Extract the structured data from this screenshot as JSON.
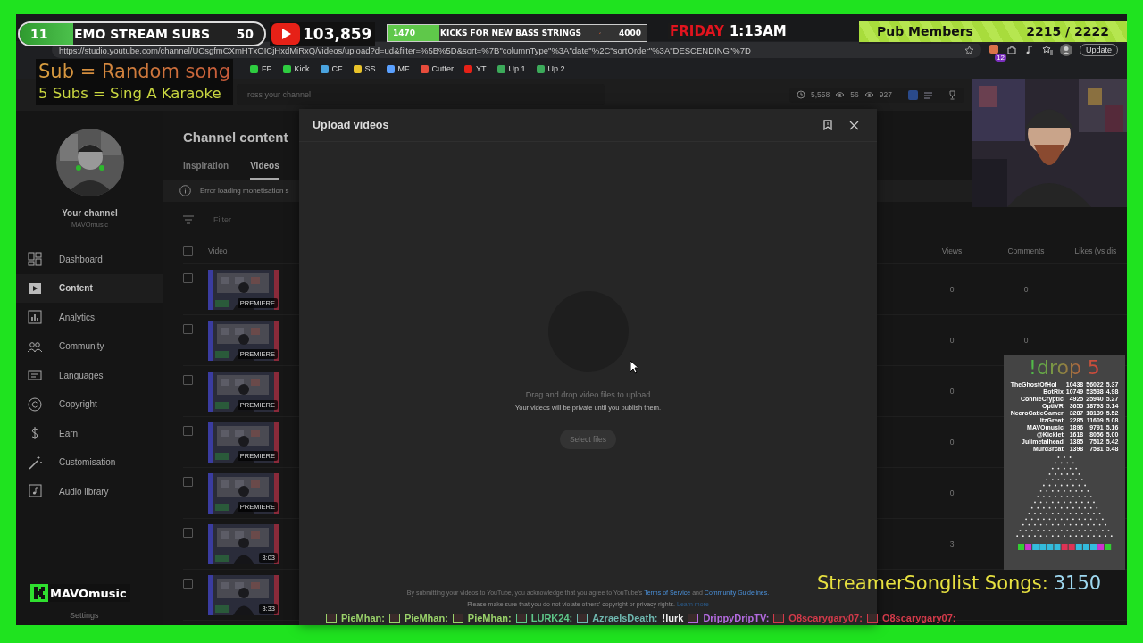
{
  "hud": {
    "subs": {
      "count": "11",
      "label": "EMO STREAM SUBS",
      "goal": "50",
      "level": 0.22
    },
    "youtube_subs": "103,859",
    "kicks": {
      "count": "1470",
      "label": "KICKS FOR NEW BASS STRINGS",
      "goal": "4000",
      "level": 0.2
    },
    "day": "FRIDAY",
    "time": "1:13AM",
    "members": {
      "label": "Pub Members",
      "count": "2215 / 2222"
    },
    "rules": [
      "Sub = Random song",
      "5 Subs = Sing A Karaoke"
    ],
    "drop": {
      "title": "!drop 5",
      "rows": [
        {
          "name": "TheGhostOfHol",
          "points": "10438",
          "total": "56022",
          "avg": "5.37"
        },
        {
          "name": "BotRix",
          "points": "10749",
          "total": "53538",
          "avg": "4.98"
        },
        {
          "name": "ConnieCryptic",
          "points": "4925",
          "total": "25940",
          "avg": "5.27"
        },
        {
          "name": "OptiVR",
          "points": "3655",
          "total": "18793",
          "avg": "5.14"
        },
        {
          "name": "NecroCatieGamer",
          "points": "3287",
          "total": "18139",
          "avg": "5.52"
        },
        {
          "name": "ItzGreat",
          "points": "2285",
          "total": "11609",
          "avg": "5.08"
        },
        {
          "name": "MAVOmusic",
          "points": "1896",
          "total": "9791",
          "avg": "5.16"
        },
        {
          "name": "@Kicklet",
          "points": "1618",
          "total": "8056",
          "avg": "5.00"
        },
        {
          "name": "Julimetalhead",
          "points": "1385",
          "total": "7512",
          "avg": "5.42"
        },
        {
          "name": "Murd3rcat",
          "points": "1398",
          "total": "7581",
          "avg": "5.48"
        }
      ]
    },
    "songlist": {
      "label": "StreamerSonglist Songs:",
      "count": "3150"
    },
    "kick_user": "MAVOmusic",
    "chat": [
      {
        "user": "PieMhan:",
        "color": "#9ad26a"
      },
      {
        "user": "PieMhan:",
        "color": "#9ad26a"
      },
      {
        "user": "PieMhan:",
        "color": "#9ad26a"
      },
      {
        "user": "LURK24:",
        "color": "#5fc98a"
      },
      {
        "user": "AzraelsDeath:",
        "color": "#6fb8b0",
        "message": "!lurk"
      },
      {
        "user": "DrippyDripTV:",
        "color": "#b46be0"
      },
      {
        "user": "O8scarygary07:",
        "color": "#d23a4a"
      },
      {
        "user": "O8scarygary07:",
        "color": "#d23a4a"
      }
    ]
  },
  "browser": {
    "url": "https://studio.youtube.com/channel/UCsgfmCXmHTxOICjHxdMiRxQ/videos/upload?d=ud&filter=%5B%5D&sort=%7B\"columnType\"%3A\"date\"%2C\"sortOrder\"%3A\"DESCENDING\"%7D",
    "extension_badge": "12",
    "update_label": "Update",
    "bookmarks": [
      "FP",
      "Kick",
      "CF",
      "SS",
      "MF",
      "Cutter",
      "YT",
      "Up 1",
      "Up 2"
    ]
  },
  "studio": {
    "search_placeholder": "ross your channel",
    "stats": [
      "5,558",
      "56",
      "927"
    ],
    "channel": {
      "title": "Your channel",
      "handle": "MAVOmusic"
    },
    "nav": [
      {
        "label": "Dashboard",
        "selected": false
      },
      {
        "label": "Content",
        "selected": true
      },
      {
        "label": "Analytics",
        "selected": false
      },
      {
        "label": "Community",
        "selected": false
      },
      {
        "label": "Languages",
        "selected": false
      },
      {
        "label": "Copyright",
        "selected": false
      },
      {
        "label": "Earn",
        "selected": false
      },
      {
        "label": "Customisation",
        "selected": false
      },
      {
        "label": "Audio library",
        "selected": false
      }
    ],
    "settings_label": "Settings",
    "page_title": "Channel content",
    "tabs": [
      {
        "label": "Inspiration",
        "selected": false
      },
      {
        "label": "Videos",
        "selected": true
      }
    ],
    "banner": "Error loading monetisation s",
    "filter_placeholder": "Filter",
    "columns": [
      "Video",
      "Views",
      "Comments",
      "Likes (vs dis"
    ],
    "header_checked": false,
    "rows": [
      {
        "checked": false,
        "badge": "PREMIERE",
        "views": "0",
        "comments": "0"
      },
      {
        "checked": false,
        "badge": "PREMIERE",
        "views": "0",
        "comments": "0"
      },
      {
        "checked": false,
        "badge": "PREMIERE",
        "views": "0"
      },
      {
        "checked": false,
        "badge": "PREMIERE",
        "views": "0"
      },
      {
        "checked": false,
        "badge": "PREMIERE",
        "views": "0"
      },
      {
        "checked": false,
        "badge": "3:03",
        "views": "3"
      },
      {
        "checked": false,
        "badge": "3:33"
      }
    ]
  },
  "dialog": {
    "title": "Upload videos",
    "drop_text": "Drag and drop video files to upload",
    "private_text": "Your videos will be private until you publish them.",
    "button": "Select files",
    "terms": "By submitting your videos to YouTube, you acknowledge that you agree to YouTube's",
    "terms_link": "Terms of Service",
    "and": "and",
    "guidelines_link": "Community Guidelines.",
    "notice": "Please make sure that you do not violate others' copyright or privacy rights.",
    "learn_more": "Learn more"
  }
}
